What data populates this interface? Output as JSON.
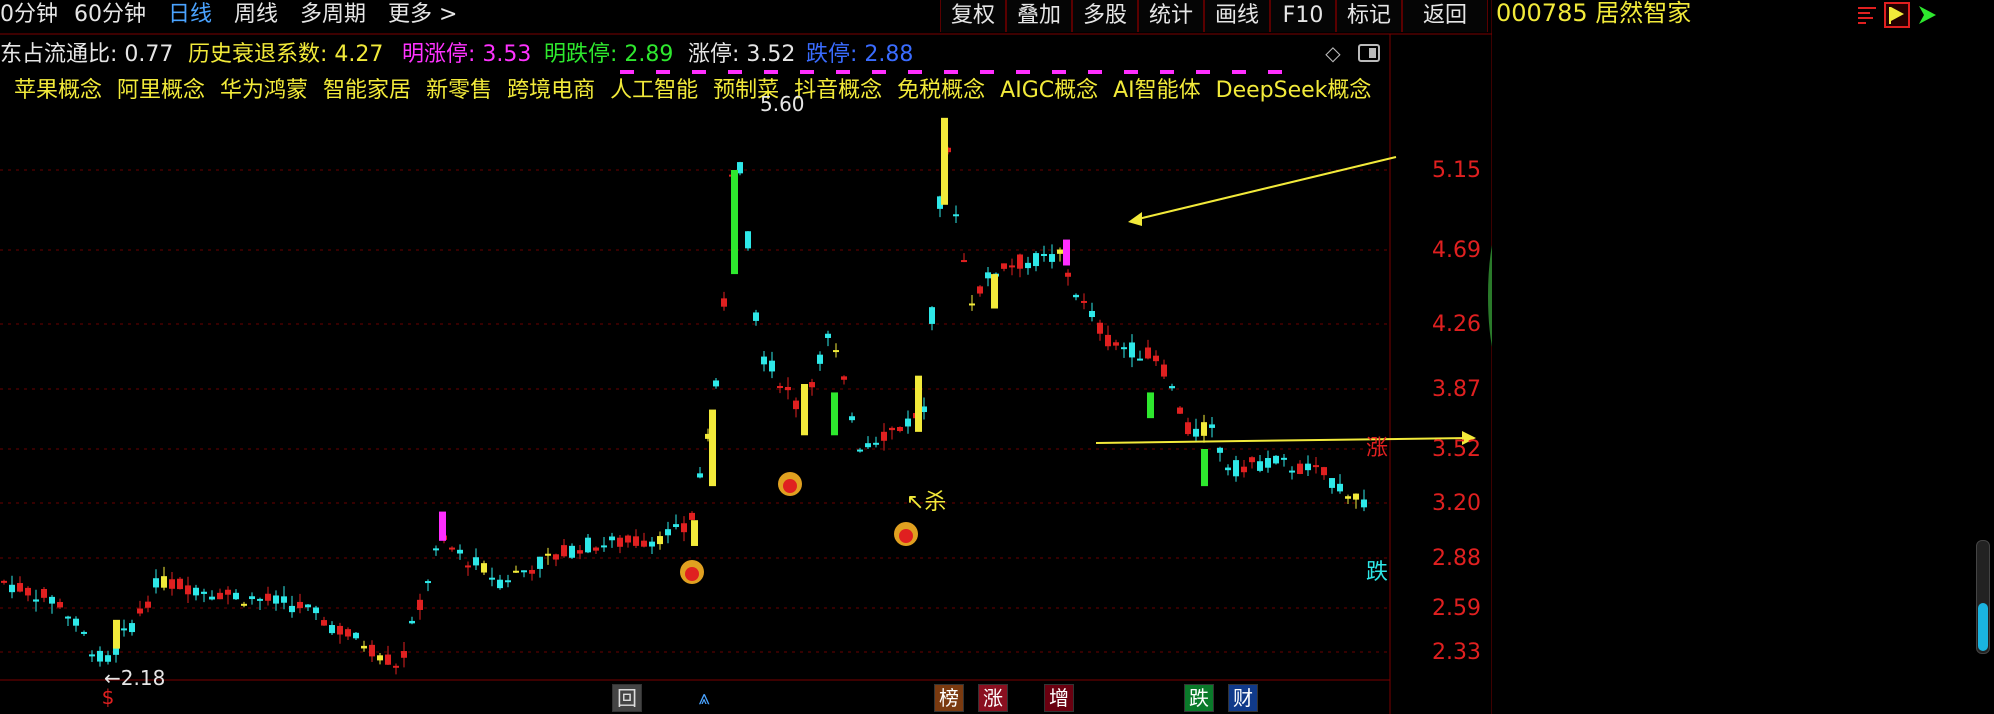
{
  "period_tabs": [
    {
      "label": "0分钟",
      "active": false
    },
    {
      "label": "60分钟",
      "active": false
    },
    {
      "label": "日线",
      "active": true
    },
    {
      "label": "周线",
      "active": false
    },
    {
      "label": "多周期",
      "active": false
    },
    {
      "label": "更多 >",
      "active": false
    }
  ],
  "toolbar_buttons": [
    "复权",
    "叠加",
    "多股",
    "统计",
    "画线",
    "F10",
    "标记",
    "返回"
  ],
  "stock": {
    "code": "000785",
    "name": "居然智家",
    "title": "000785 居然智家"
  },
  "info": {
    "float_ratio_label": "东占流通比:",
    "float_ratio_value": "0.77",
    "decay_label": "历史衰退系数:",
    "decay_value": "4.27",
    "next_limit_up_label": "明涨停:",
    "next_limit_up_value": "3.53",
    "next_limit_down_label": "明跌停:",
    "next_limit_down_value": "2.89",
    "limit_up_label": "涨停:",
    "limit_up_value": "3.52",
    "limit_down_label": "跌停:",
    "limit_down_value": "2.88",
    "colors": {
      "float": "#e6e6e6",
      "decay": "#f2ea3a",
      "next_up": "#ff33ff",
      "next_down": "#2ee82e",
      "limit_up": "#e6e6e6",
      "limit_down": "#3a6cff"
    }
  },
  "concepts": [
    "苹果概念",
    "阿里概念",
    "华为鸿蒙",
    "智能家居",
    "新零售",
    "跨境电商",
    "人工智能",
    "预制菜",
    "抖音概念",
    "免税概念",
    "AIGC概念",
    "AI智能体",
    "DeepSeek概念"
  ],
  "price_axis": [
    "5.15",
    "4.69",
    "4.26",
    "3.87",
    "3.52",
    "3.20",
    "2.88",
    "2.59",
    "2.33"
  ],
  "annotations": {
    "high_label": "5.60",
    "low_label": "←2.18",
    "sell_label": "↖杀",
    "limit_up_marker": "涨",
    "limit_down_marker": "跌"
  },
  "bottom_tags": [
    {
      "label": "$",
      "color": "#e02020"
    },
    {
      "label": "回",
      "color": "#bbbbbb"
    },
    {
      "label": "⩓",
      "color": "#4aa3ff"
    },
    {
      "label": "榜",
      "color": "#ffffff"
    },
    {
      "label": "涨",
      "color": "#ffffff"
    },
    {
      "label": "增",
      "color": "#ffffff"
    },
    {
      "label": "跌",
      "color": "#ffffff"
    },
    {
      "label": "财",
      "color": "#ffffff"
    }
  ],
  "icons": [
    "chip-distribution-icon",
    "flag-icon",
    "arrow-tool-icon",
    "scroll-handle-icon"
  ],
  "theme": {
    "bg": "#000000",
    "up": "#e02020",
    "down": "#2ee8e8",
    "grid": "#6a0000",
    "accent": "#f2ea3a"
  }
}
